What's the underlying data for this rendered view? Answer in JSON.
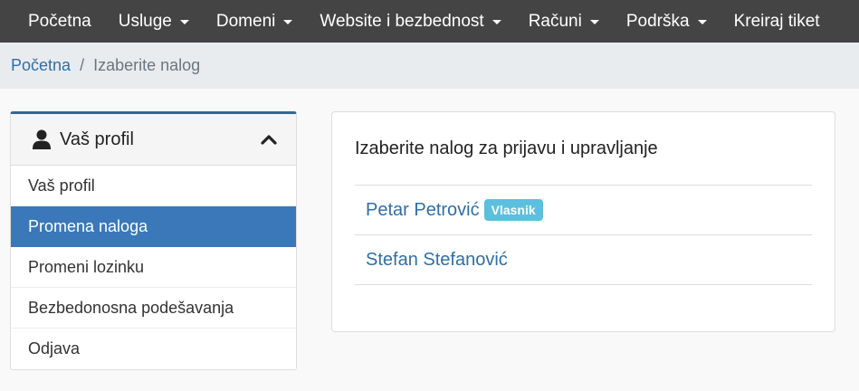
{
  "nav": {
    "items": [
      {
        "label": "Početna",
        "dropdown": false
      },
      {
        "label": "Usluge",
        "dropdown": true
      },
      {
        "label": "Domeni",
        "dropdown": true
      },
      {
        "label": "Website i bezbednost",
        "dropdown": true
      },
      {
        "label": "Računi",
        "dropdown": true
      },
      {
        "label": "Podrška",
        "dropdown": true
      },
      {
        "label": "Kreiraj tiket",
        "dropdown": false
      }
    ]
  },
  "breadcrumb": {
    "home": "Početna",
    "separator": "/",
    "current": "Izaberite nalog"
  },
  "sidebar": {
    "header": "Vaš profil",
    "header_icon": "user-icon",
    "toggle_icon": "chevron-up-icon",
    "items": [
      {
        "label": "Vaš profil",
        "active": false
      },
      {
        "label": "Promena naloga",
        "active": true
      },
      {
        "label": "Promeni lozinku",
        "active": false
      },
      {
        "label": "Bezbedonosna podešavanja",
        "active": false
      },
      {
        "label": "Odjava",
        "active": false
      }
    ]
  },
  "main": {
    "title": "Izaberite nalog za prijavu i upravljanje",
    "accounts": [
      {
        "name": "Petar Petrović",
        "badge": "Vlasnik"
      },
      {
        "name": "Stefan Stefanović",
        "badge": ""
      }
    ]
  },
  "colors": {
    "nav_bg": "#444444",
    "accent": "#3a78b9",
    "link": "#2f6fa7",
    "badge": "#5bc0de"
  }
}
